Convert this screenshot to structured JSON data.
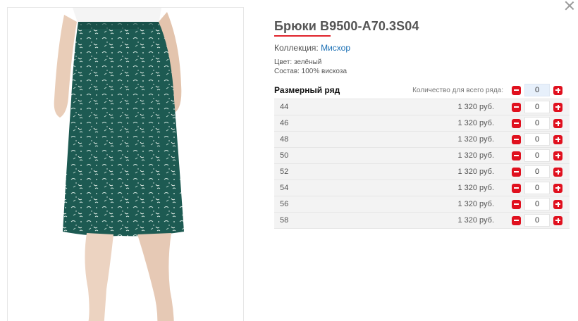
{
  "product": {
    "title": "Брюки B9500-A70.3S04",
    "collection_label": "Коллекция:",
    "collection_name": "Мисхор",
    "color_line": "Цвет: зелёный",
    "composition_line": "Состав: 100% вискоза"
  },
  "sizes": {
    "heading": "Размерный ряд",
    "qty_all_label": "Количество для всего ряда:",
    "qty_all_value": "0",
    "rows": [
      {
        "size": "44",
        "price": "1 320 руб.",
        "qty": "0"
      },
      {
        "size": "46",
        "price": "1 320 руб.",
        "qty": "0"
      },
      {
        "size": "48",
        "price": "1 320 руб.",
        "qty": "0"
      },
      {
        "size": "50",
        "price": "1 320 руб.",
        "qty": "0"
      },
      {
        "size": "52",
        "price": "1 320 руб.",
        "qty": "0"
      },
      {
        "size": "54",
        "price": "1 320 руб.",
        "qty": "0"
      },
      {
        "size": "56",
        "price": "1 320 руб.",
        "qty": "0"
      },
      {
        "size": "58",
        "price": "1 320 руб.",
        "qty": "0"
      }
    ]
  },
  "icons": {
    "close": "close-icon",
    "minus": "minus-icon",
    "plus": "plus-icon"
  },
  "colors": {
    "accent_red": "#e0101e",
    "underline_red": "#e0232b",
    "link_blue": "#1a6fb5",
    "fabric_green": "#1d5a52"
  }
}
